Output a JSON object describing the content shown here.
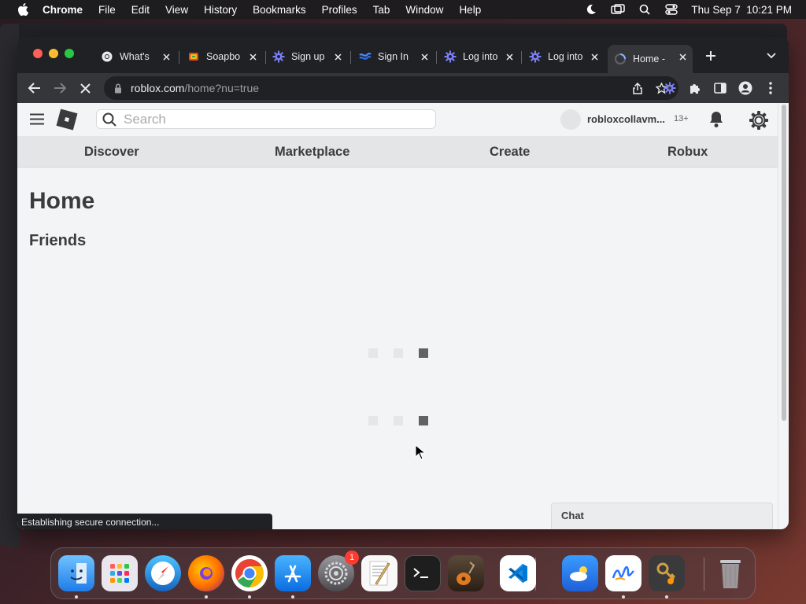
{
  "menubar": {
    "app": "Chrome",
    "items": [
      "File",
      "Edit",
      "View",
      "History",
      "Bookmarks",
      "Profiles",
      "Tab",
      "Window",
      "Help"
    ],
    "datetime": "Thu Sep 7  10:21 PM"
  },
  "tabs": [
    {
      "title": "What's",
      "icon": "chrome-icon"
    },
    {
      "title": "Soapbo",
      "icon": "soapbox-icon"
    },
    {
      "title": "Sign up",
      "icon": "gear-badge-icon"
    },
    {
      "title": "Sign In",
      "icon": "wave-logo-icon"
    },
    {
      "title": "Log into",
      "icon": "gear-badge-icon"
    },
    {
      "title": "Log into",
      "icon": "gear-badge-icon"
    },
    {
      "title": "Home -",
      "icon": "loading-icon",
      "active": true
    }
  ],
  "omnibox": {
    "host": "roblox.com",
    "path": "/home?nu=true"
  },
  "roblox": {
    "search_placeholder": "Search",
    "username": "robloxcollavm...",
    "age_badge": "13+",
    "nav": [
      "Discover",
      "Marketplace",
      "Create",
      "Robux"
    ],
    "home_title": "Home",
    "friends_title": "Friends",
    "chat_label": "Chat"
  },
  "status": "Establishing secure connection...",
  "dock": {
    "settings_badge": "1"
  },
  "colors": {
    "tabstrip": "#202124",
    "toolbar": "#35363a",
    "page_bg": "#f2f4f5",
    "text_dark": "#393b3d"
  }
}
